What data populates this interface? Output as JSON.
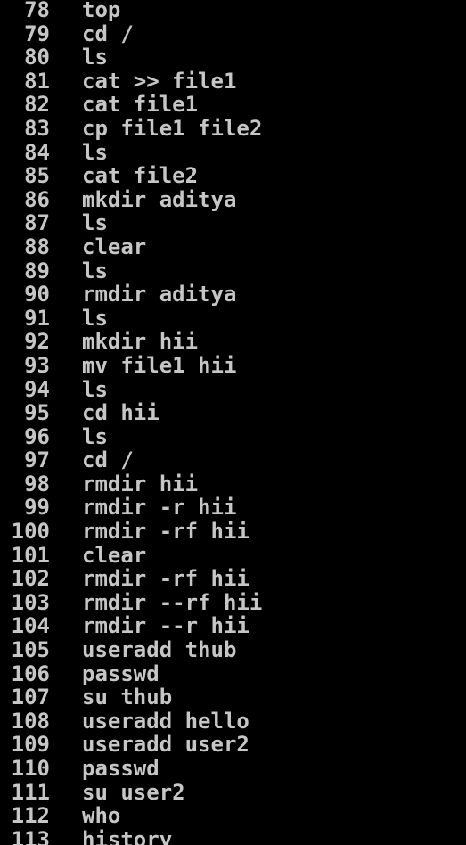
{
  "colors": {
    "background": "#000000",
    "text": "#c6c6c6"
  },
  "history": [
    {
      "num": "78",
      "cmd": "top"
    },
    {
      "num": "79",
      "cmd": "cd /"
    },
    {
      "num": "80",
      "cmd": "ls"
    },
    {
      "num": "81",
      "cmd": "cat >> file1"
    },
    {
      "num": "82",
      "cmd": "cat file1"
    },
    {
      "num": "83",
      "cmd": "cp file1 file2"
    },
    {
      "num": "84",
      "cmd": "ls"
    },
    {
      "num": "85",
      "cmd": "cat file2"
    },
    {
      "num": "86",
      "cmd": "mkdir aditya"
    },
    {
      "num": "87",
      "cmd": "ls"
    },
    {
      "num": "88",
      "cmd": "clear"
    },
    {
      "num": "89",
      "cmd": "ls"
    },
    {
      "num": "90",
      "cmd": "rmdir aditya"
    },
    {
      "num": "91",
      "cmd": "ls"
    },
    {
      "num": "92",
      "cmd": "mkdir hii"
    },
    {
      "num": "93",
      "cmd": "mv file1 hii"
    },
    {
      "num": "94",
      "cmd": "ls"
    },
    {
      "num": "95",
      "cmd": "cd hii"
    },
    {
      "num": "96",
      "cmd": "ls"
    },
    {
      "num": "97",
      "cmd": "cd /"
    },
    {
      "num": "98",
      "cmd": "rmdir hii"
    },
    {
      "num": "99",
      "cmd": "rmdir -r hii"
    },
    {
      "num": "100",
      "cmd": "rmdir -rf hii"
    },
    {
      "num": "101",
      "cmd": "clear"
    },
    {
      "num": "102",
      "cmd": "rmdir -rf hii"
    },
    {
      "num": "103",
      "cmd": "rmdir --rf hii"
    },
    {
      "num": "104",
      "cmd": "rmdir --r hii"
    },
    {
      "num": "105",
      "cmd": "useradd thub"
    },
    {
      "num": "106",
      "cmd": "passwd"
    },
    {
      "num": "107",
      "cmd": "su thub"
    },
    {
      "num": "108",
      "cmd": "useradd hello"
    },
    {
      "num": "109",
      "cmd": "useradd user2"
    },
    {
      "num": "110",
      "cmd": "passwd"
    },
    {
      "num": "111",
      "cmd": "su user2"
    },
    {
      "num": "112",
      "cmd": "who"
    },
    {
      "num": "113",
      "cmd": "history"
    }
  ]
}
